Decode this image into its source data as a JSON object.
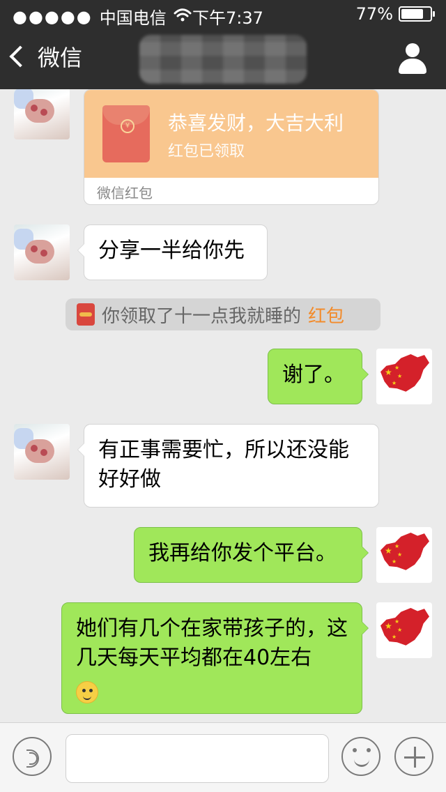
{
  "status_bar": {
    "signal_dots": "●●●●●",
    "carrier": "中国电信",
    "time": "下午7:37",
    "battery": "77%",
    "battery_level": 0.77
  },
  "nav": {
    "back_label": "微信",
    "title_blurred": true
  },
  "chat": {
    "messages": [
      {
        "type": "red_packet",
        "side": "left",
        "title": "恭喜发财，大吉大利",
        "status": "红包已领取",
        "footer": "微信红包",
        "avatar": "baby-hand-avatar"
      },
      {
        "type": "text",
        "side": "left",
        "text": "分享一半给你先",
        "avatar": "baby-hand-avatar"
      },
      {
        "type": "system",
        "text_prefix": "你领取了十一点我就睡的",
        "text_highlight": "红包"
      },
      {
        "type": "text",
        "side": "right",
        "text": "谢了。",
        "avatar": "china-map-avatar"
      },
      {
        "type": "text",
        "side": "left",
        "text": "有正事需要忙，所以还没能好好做",
        "avatar": "baby-hand-avatar"
      },
      {
        "type": "text",
        "side": "right",
        "text": "我再给你发个平台。",
        "avatar": "china-map-avatar"
      },
      {
        "type": "text",
        "side": "right",
        "text": "她们有几个在家带孩子的，这几天每天平均都在40左右",
        "emoji": "smiling-emoji",
        "avatar": "china-map-avatar"
      }
    ]
  },
  "input_bar": {
    "voice_icon": "voice-icon",
    "emoji_icon": "emoji-icon",
    "plus_icon": "plus-icon",
    "input_value": ""
  },
  "colors": {
    "topbar": "#2e2e2e",
    "chat_bg": "#ebebeb",
    "bubble_right": "#a0e75a",
    "red_packet": "#f9c78f",
    "highlight": "#f28b2b"
  }
}
